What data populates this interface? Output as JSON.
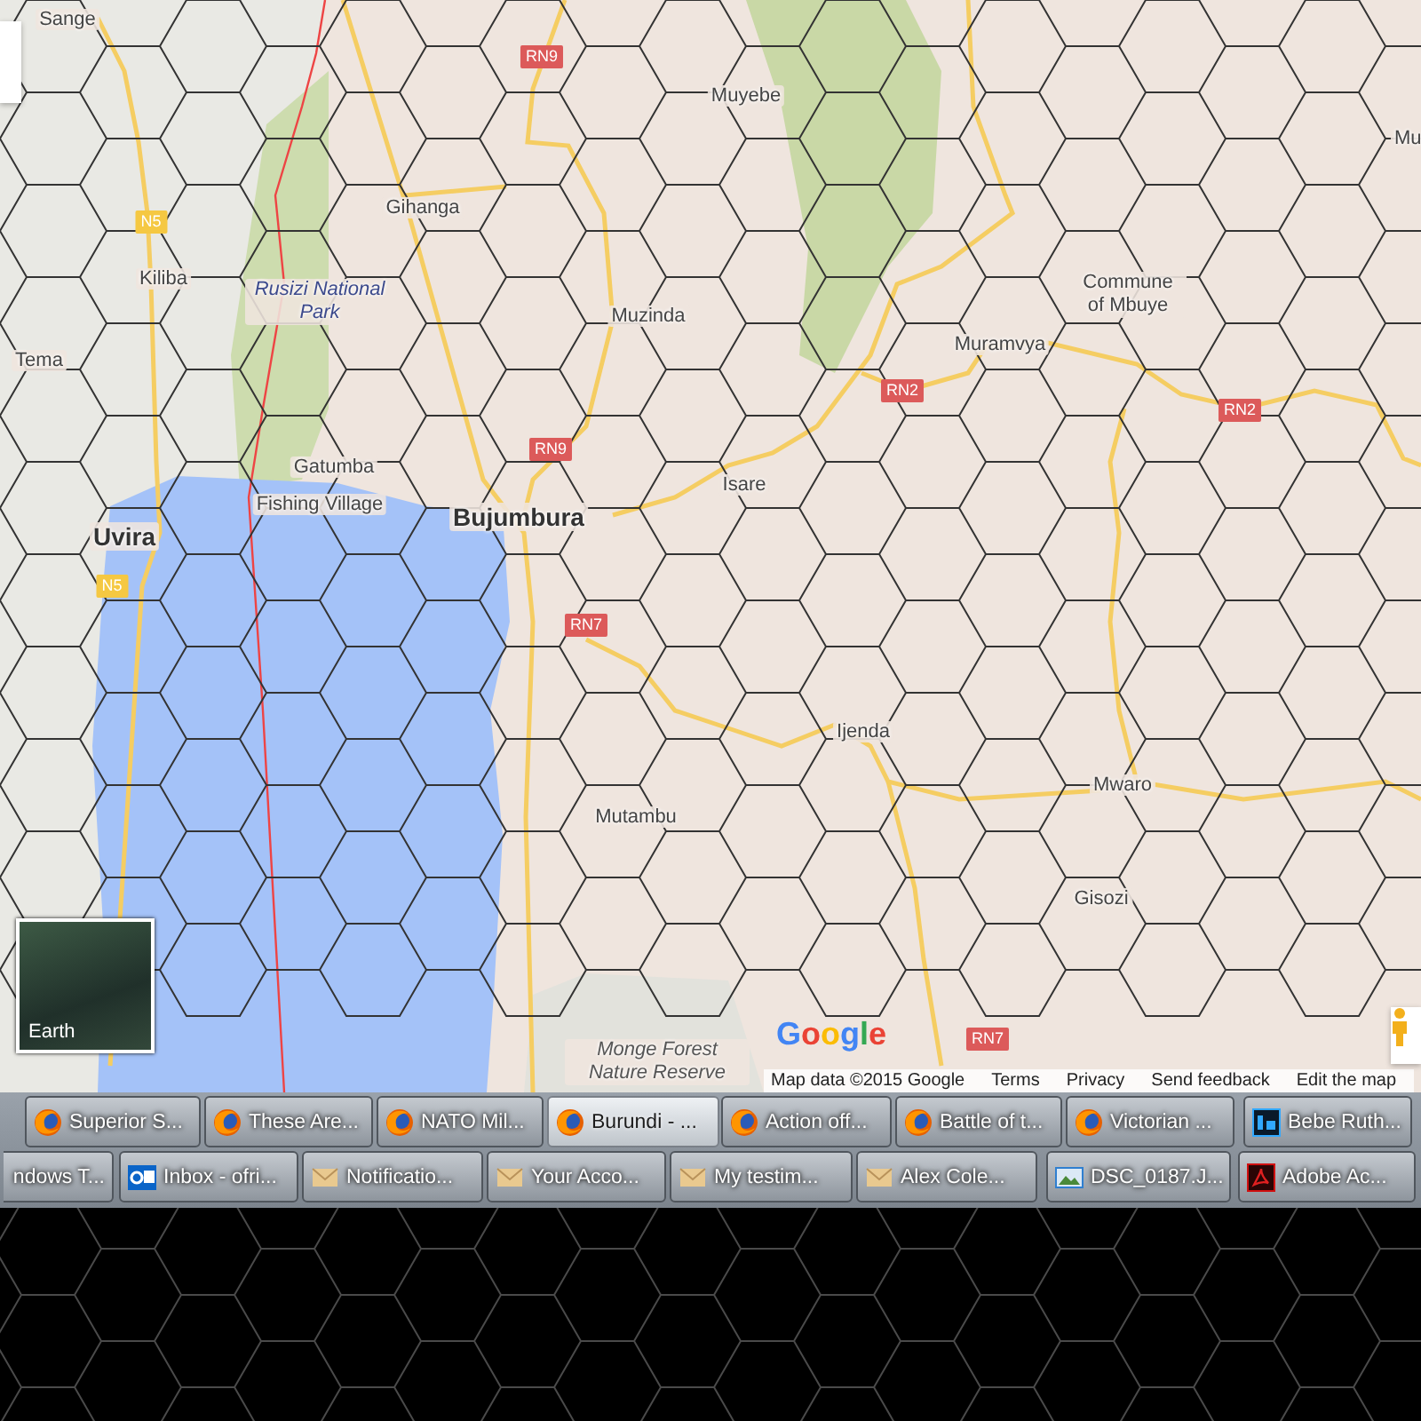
{
  "map": {
    "places": [
      {
        "name": "Sange",
        "kind": "town"
      },
      {
        "name": "Muyebe",
        "kind": "town"
      },
      {
        "name": "Gihanga",
        "kind": "town"
      },
      {
        "name": "Kiliba",
        "kind": "town"
      },
      {
        "name": "Rusizi National Park",
        "kind": "park"
      },
      {
        "name": "Muzinda",
        "kind": "town"
      },
      {
        "name": "Tema",
        "kind": "town"
      },
      {
        "name": "Commune of Mbuye",
        "kind": "town"
      },
      {
        "name": "Muramvya",
        "kind": "town"
      },
      {
        "name": "Isare",
        "kind": "town"
      },
      {
        "name": "Gatumba",
        "kind": "town"
      },
      {
        "name": "Fishing Village",
        "kind": "town"
      },
      {
        "name": "Bujumbura",
        "kind": "city"
      },
      {
        "name": "Uvira",
        "kind": "city"
      },
      {
        "name": "Ijenda",
        "kind": "town"
      },
      {
        "name": "Mwaro",
        "kind": "town"
      },
      {
        "name": "Mutambu",
        "kind": "town"
      },
      {
        "name": "Gisozi",
        "kind": "town"
      },
      {
        "name": "Monge Forest Nature Reserve",
        "kind": "reserve"
      },
      {
        "name": "Mu",
        "kind": "town"
      }
    ],
    "road_markers": [
      {
        "label": "RN9",
        "color": "#dc5a5a"
      },
      {
        "label": "N5",
        "color": "#f5c842"
      },
      {
        "label": "RN2",
        "color": "#dc5a5a"
      },
      {
        "label": "RN2",
        "color": "#dc5a5a"
      },
      {
        "label": "RN9",
        "color": "#dc5a5a"
      },
      {
        "label": "N5",
        "color": "#f5c842"
      },
      {
        "label": "RN7",
        "color": "#dc5a5a"
      },
      {
        "label": "RN7",
        "color": "#dc5a5a"
      }
    ],
    "earth_button": {
      "label": "Earth"
    },
    "logo": "Google",
    "attribution": {
      "data": "Map data ©2015 Google",
      "links": [
        "Terms",
        "Privacy",
        "Send feedback",
        "Edit the map"
      ]
    }
  },
  "taskbar": {
    "rows": [
      [
        {
          "label": "Superior S...",
          "kind": "browser",
          "selected": false
        },
        {
          "label": "These Are...",
          "kind": "browser",
          "selected": false
        },
        {
          "label": "NATO Mil...",
          "kind": "browser",
          "selected": false
        },
        {
          "label": "Burundi - ...",
          "kind": "browser",
          "selected": true
        },
        {
          "label": "Action off...",
          "kind": "browser",
          "selected": false
        },
        {
          "label": "Battle of t...",
          "kind": "browser",
          "selected": false
        },
        {
          "label": "Victorian ...",
          "kind": "browser",
          "selected": false
        },
        {
          "label": "Bebe Ruth...",
          "kind": "photoshop",
          "selected": false
        }
      ],
      [
        {
          "label": "ndows T...",
          "kind": "none",
          "selected": false
        },
        {
          "label": "Inbox - ofri...",
          "kind": "outlook",
          "selected": false
        },
        {
          "label": "Notificatio...",
          "kind": "mail",
          "selected": false
        },
        {
          "label": "Your Acco...",
          "kind": "mail",
          "selected": false
        },
        {
          "label": "My testim...",
          "kind": "mail",
          "selected": false
        },
        {
          "label": "Alex Cole...",
          "kind": "mail",
          "selected": false
        },
        {
          "label": "DSC_0187.J...",
          "kind": "image",
          "selected": false
        },
        {
          "label": "Adobe Ac...",
          "kind": "pdf",
          "selected": false
        }
      ]
    ]
  }
}
